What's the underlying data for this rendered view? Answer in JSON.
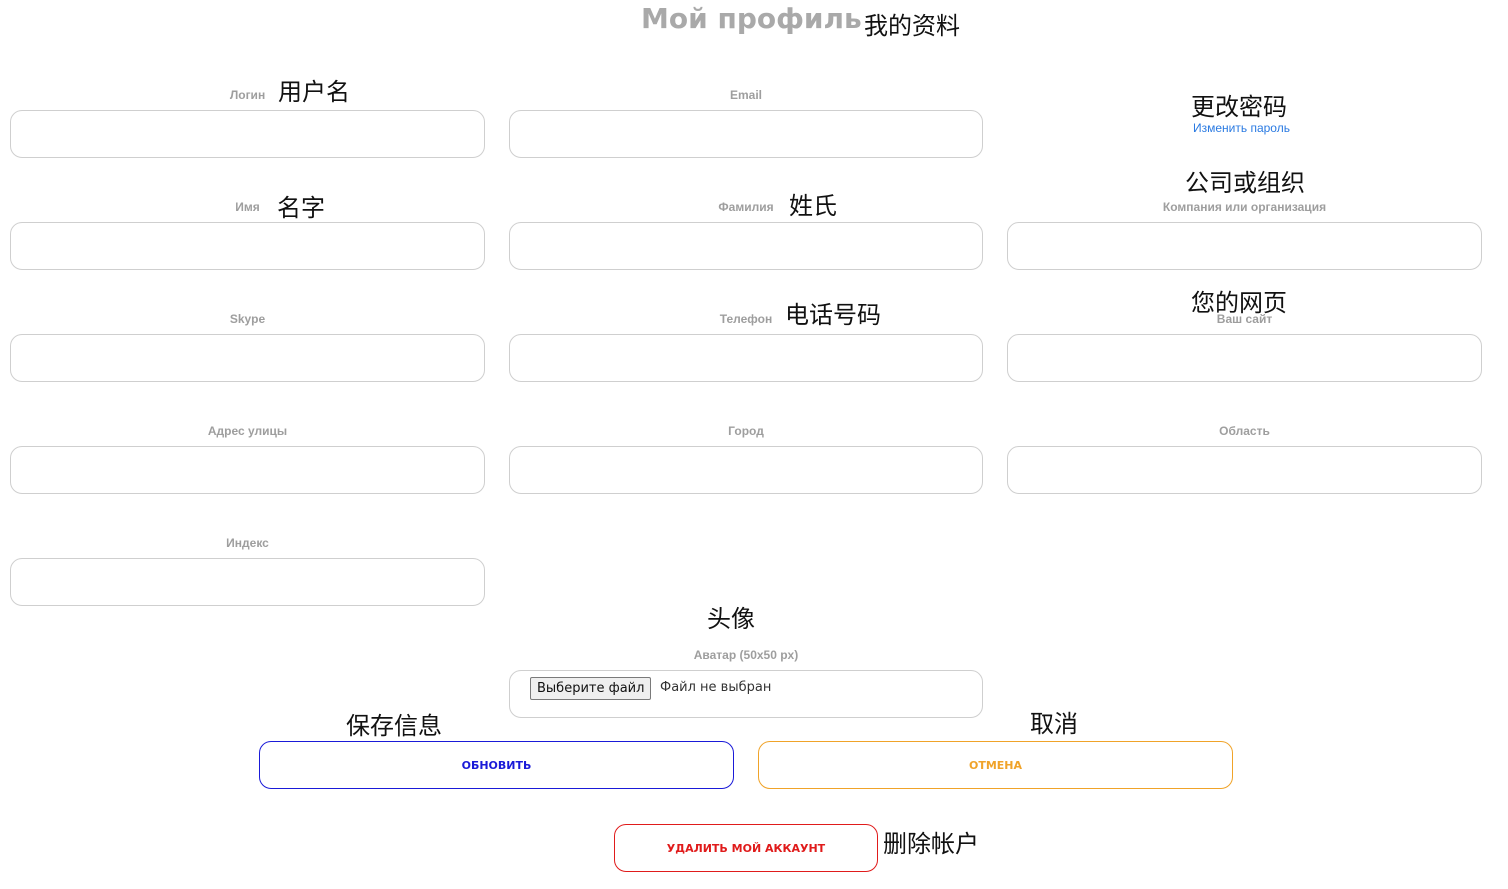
{
  "header": {
    "title": "Мой профиль",
    "title_note": "我的资料"
  },
  "fields": {
    "login": {
      "label": "Логин",
      "note": "用户名",
      "value": ""
    },
    "email": {
      "label": "Email",
      "value": ""
    },
    "first_name": {
      "label": "Имя",
      "note": "名字",
      "value": ""
    },
    "last_name": {
      "label": "Фамилия",
      "note": "姓氏",
      "value": ""
    },
    "company": {
      "label": "Компания или организация",
      "note": "公司或组织",
      "value": ""
    },
    "skype": {
      "label": "Skype",
      "value": ""
    },
    "phone": {
      "label": "Телефон",
      "note": "电话号码",
      "value": ""
    },
    "website": {
      "label": "Ваш сайт",
      "note": "您的网页",
      "value": ""
    },
    "street": {
      "label": "Адрес улицы",
      "value": ""
    },
    "city": {
      "label": "Город",
      "value": ""
    },
    "region": {
      "label": "Область",
      "value": ""
    },
    "zip": {
      "label": "Индекс",
      "value": ""
    }
  },
  "password": {
    "note": "更改密码",
    "link_label": "Изменить пароль"
  },
  "avatar": {
    "note": "头像",
    "label": "Аватар (50x50 px)",
    "choose_button": "Выберите файл",
    "no_file_text": "Файл не выбран"
  },
  "actions": {
    "update_label": "ОБНОВИТЬ",
    "update_note": "保存信息",
    "cancel_label": "ОТМЕНА",
    "cancel_note": "取消",
    "delete_label": "УДАЛИТЬ МОЙ АККАУНТ",
    "delete_note": "删除帐户"
  },
  "colors": {
    "title_gray": "#a9a9a9",
    "link_blue": "#2a7ae2",
    "update_blue": "#1a1ad8",
    "cancel_orange": "#f0a329",
    "delete_red": "#e01b1b"
  }
}
